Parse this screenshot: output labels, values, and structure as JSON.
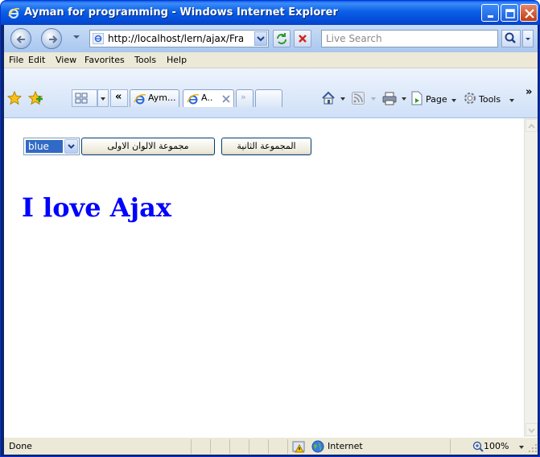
{
  "window": {
    "title": "Ayman for programming - Windows Internet Explorer"
  },
  "address": {
    "url": "http://localhost/lern/ajax/Fram",
    "search_placeholder": "Live Search"
  },
  "menu": [
    "File",
    "Edit",
    "View",
    "Favorites",
    "Tools",
    "Help"
  ],
  "tabs": [
    {
      "label": "Aym..."
    },
    {
      "label": "A.."
    }
  ],
  "toolbar": {
    "page_label": "Page",
    "tools_label": "Tools"
  },
  "page": {
    "select_value": "blue",
    "button_group1": "مجموعة الالوان الاولى",
    "button_group2": "المجموعة الثانية",
    "heading": "I love Ajax",
    "heading_color": "#0000ff"
  },
  "status": {
    "text": "Done",
    "zone": "Internet",
    "zoom": "100%"
  }
}
